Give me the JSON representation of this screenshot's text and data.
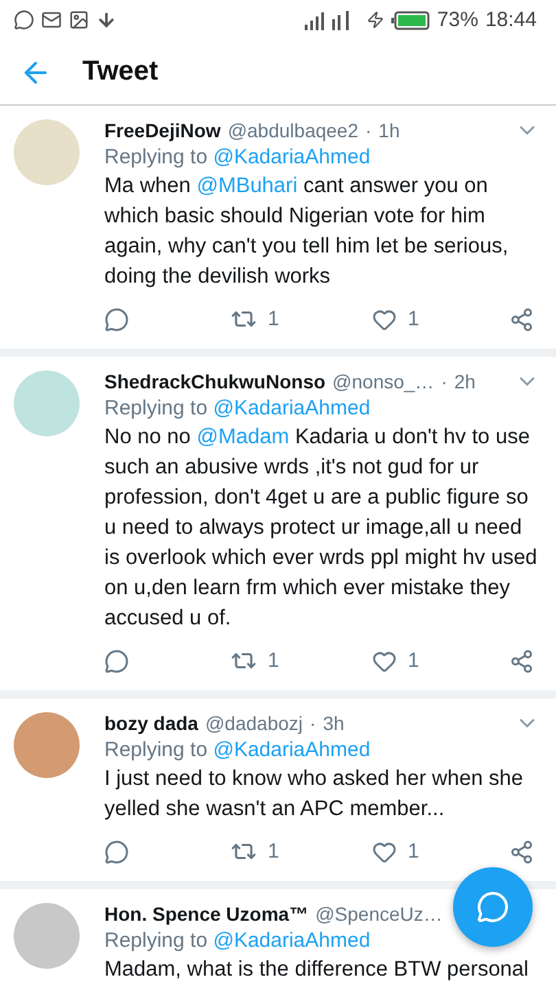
{
  "status_bar": {
    "battery_percent": "73%",
    "time": "18:44"
  },
  "header": {
    "title": "Tweet"
  },
  "tweets": [
    {
      "name": "FreeDejiNow",
      "handle": "@abdulbaqee2",
      "separator": "·",
      "time": "1h",
      "replying_label": "Replying to",
      "replying_to": "@KadariaAhmed",
      "body": [
        {
          "kind": "plain",
          "text": "Ma when "
        },
        {
          "kind": "mention",
          "text": "@MBuhari"
        },
        {
          "kind": "plain",
          "text": " cant answer you on which basic should Nigerian vote for him again, why can't you tell him let be serious, doing the devilish works"
        }
      ],
      "retweets": "1",
      "likes": "1"
    },
    {
      "name": "ShedrackChukwuNonso",
      "handle": "@nonso_…",
      "separator": "·",
      "time": "2h",
      "replying_label": "Replying to",
      "replying_to": "@KadariaAhmed",
      "body": [
        {
          "kind": "plain",
          "text": "No no no "
        },
        {
          "kind": "mention",
          "text": "@Madam"
        },
        {
          "kind": "plain",
          "text": " Kadaria u don't hv to use such an abusive wrds ,it's not gud for ur profession, don't 4get u are a public figure so u need to always protect ur image,all u need is overlook which ever wrds ppl might hv used on u,den learn frm which ever mistake they accused u of."
        }
      ],
      "retweets": "1",
      "likes": "1"
    },
    {
      "name": "bozy dada",
      "handle": "@dadabozj",
      "separator": "·",
      "time": "3h",
      "replying_label": "Replying to",
      "replying_to": "@KadariaAhmed",
      "body": [
        {
          "kind": "plain",
          "text": "I just need to know who asked her when she yelled she wasn't an APC member..."
        }
      ],
      "retweets": "1",
      "likes": "1"
    },
    {
      "name": "Hon. Spence Uzoma™",
      "handle": "@SpenceUz…",
      "replying_label": "Replying to",
      "replying_to": "@KadariaAhmed",
      "body": [
        {
          "kind": "plain",
          "text": "Madam, what is the difference BTW personal"
        }
      ]
    }
  ]
}
